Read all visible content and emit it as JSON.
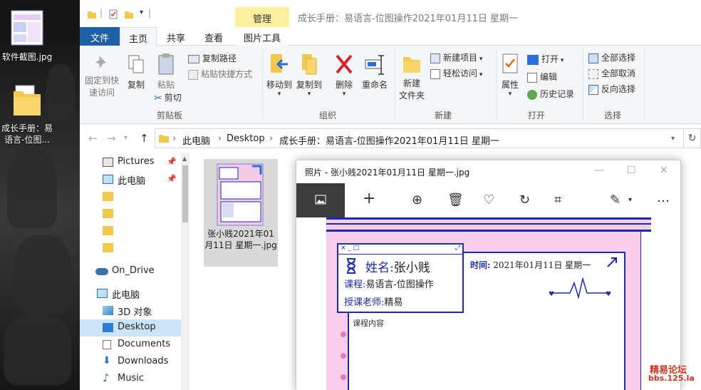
{
  "desktop": {
    "icons": [
      {
        "label": "软件截图.jpg"
      },
      {
        "label": "成长手册：易语言-位图..."
      }
    ]
  },
  "explorer": {
    "title": "成长手册：易语言-位图操作2021年01月11日 星期一",
    "contextual_tab": "管理",
    "tabs": [
      "文件",
      "主页",
      "共享",
      "查看",
      "图片工具"
    ],
    "ribbon": {
      "clipboard": {
        "pin": "固定到快速访问",
        "copy": "复制",
        "paste": "粘贴",
        "copy_path": "复制路径",
        "paste_shortcut": "粘贴快捷方式",
        "cut": "剪切",
        "label": "剪贴板"
      },
      "organize": {
        "move_to": "移动到",
        "copy_to": "复制到",
        "delete": "删除",
        "rename": "重命名",
        "label": "组织"
      },
      "new": {
        "new_folder_l1": "新建",
        "new_folder_l2": "文件夹",
        "new_item": "新建项目",
        "easy_access": "轻松访问",
        "label": "新建"
      },
      "open": {
        "properties": "属性",
        "open": "打开",
        "edit": "编辑",
        "history": "历史记录",
        "label": "打开"
      },
      "select": {
        "select_all": "全部选择",
        "select_none": "全部取消",
        "invert": "反向选择",
        "label": "选择"
      }
    },
    "address": {
      "crumbs": [
        "此电脑",
        "Desktop",
        "成长手册：易语言-位图操作2021年01月11日 星期一"
      ]
    },
    "nav": [
      {
        "label": "Pictures"
      },
      {
        "label": "此电脑"
      },
      {
        "label": "On_Drive"
      },
      {
        "label": "此电脑"
      },
      {
        "label": "3D 对象"
      },
      {
        "label": "Desktop"
      },
      {
        "label": "Documents"
      },
      {
        "label": "Downloads"
      },
      {
        "label": "Music"
      }
    ],
    "file": {
      "name": "张小贱2021年01月11日 星期一.jpg"
    }
  },
  "photos": {
    "title": "照片 - 张小贱2021年01月11日 星期一.jpg",
    "card": {
      "name_label": "姓名:",
      "name_value": "张小贱",
      "course_label": "课程:",
      "course_value": "易语言-位图操作",
      "teacher_label": "授课老师:",
      "teacher_value": "精易"
    },
    "panel": {
      "time_label": "时间:",
      "time_value": "2021年01月11日  星期一",
      "content_label": "课程内容"
    }
  },
  "watermark": {
    "line1": "精易论坛",
    "line2": "bbs.125.la"
  },
  "colors": {
    "accent": "#1f5fa5",
    "brand_blue": "#1c2bb0",
    "pink": "#f7cdea"
  }
}
